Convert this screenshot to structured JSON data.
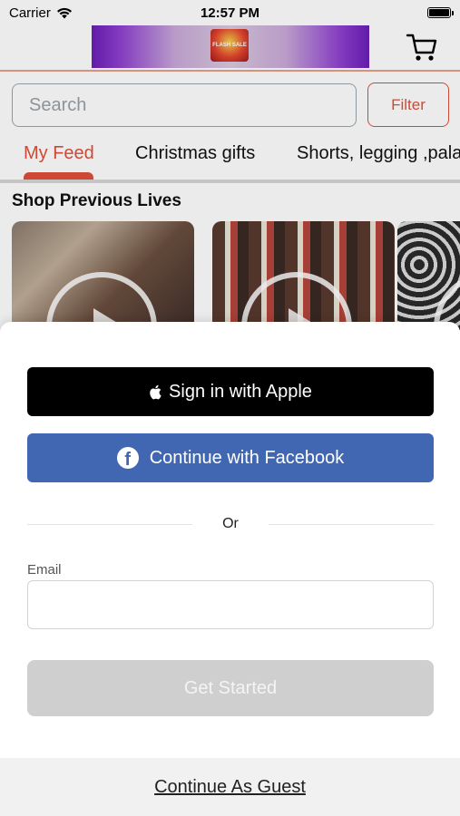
{
  "status_bar": {
    "carrier": "Carrier",
    "time": "12:57 PM"
  },
  "header": {
    "banner_logo_text": "FLASH SALE",
    "cart_icon": "cart-icon"
  },
  "search": {
    "placeholder": "Search",
    "filter_label": "Filter"
  },
  "tabs": [
    {
      "label": "My Feed",
      "active": true
    },
    {
      "label": "Christmas gifts",
      "active": false
    },
    {
      "label": "Shorts, legging ,pala",
      "active": false
    }
  ],
  "section": {
    "title": "Shop Previous Lives"
  },
  "colors": {
    "accent": "#e0503a",
    "facebook": "#4267b2",
    "apple": "#000000",
    "disabled_button": "#cfcfcf"
  },
  "sheet": {
    "apple_button": "Sign in with Apple",
    "facebook_button": "Continue with Facebook",
    "divider_text": "Or",
    "email_label": "Email",
    "email_value": "",
    "get_started": "Get Started",
    "guest_link": "Continue As Guest"
  }
}
